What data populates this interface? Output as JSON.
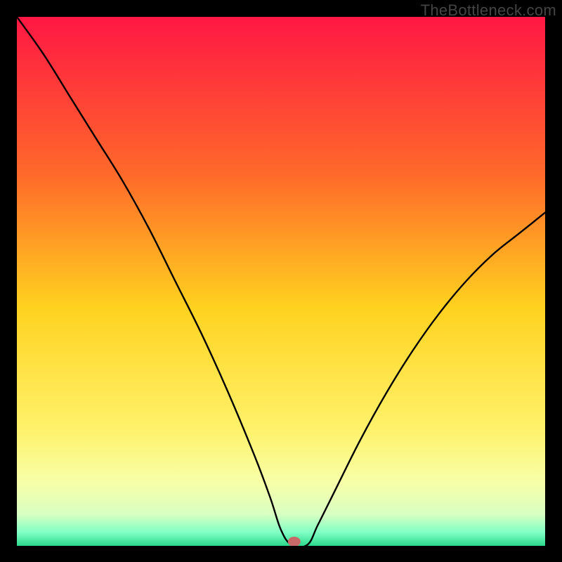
{
  "watermark": "TheBottleneck.com",
  "chart_data": {
    "type": "line",
    "title": "",
    "xlabel": "",
    "ylabel": "",
    "xlim": [
      0,
      100
    ],
    "ylim": [
      0,
      100
    ],
    "grid": false,
    "legend": false,
    "marker": {
      "x": 52.5,
      "y": 0,
      "color": "#c96a6a"
    },
    "series": [
      {
        "name": "bottleneck-curve",
        "x": [
          0,
          5,
          10,
          15,
          20,
          25,
          30,
          35,
          40,
          45,
          48,
          50,
          52,
          55,
          57,
          60,
          65,
          70,
          75,
          80,
          85,
          90,
          95,
          100
        ],
        "values": [
          100,
          93,
          85,
          77,
          69,
          60,
          50,
          40,
          29,
          17,
          9,
          3,
          0.2,
          0.2,
          4,
          10,
          20,
          29,
          37,
          44,
          50,
          55,
          59,
          63
        ]
      }
    ],
    "gradient_stops": [
      {
        "pos": 0.0,
        "color": "#ff1744"
      },
      {
        "pos": 0.3,
        "color": "#ff6a2a"
      },
      {
        "pos": 0.55,
        "color": "#ffd21f"
      },
      {
        "pos": 0.78,
        "color": "#fff26b"
      },
      {
        "pos": 0.88,
        "color": "#f7ffa8"
      },
      {
        "pos": 0.94,
        "color": "#d9ffc2"
      },
      {
        "pos": 0.975,
        "color": "#7fffc4"
      },
      {
        "pos": 1.0,
        "color": "#2bd88a"
      }
    ]
  }
}
